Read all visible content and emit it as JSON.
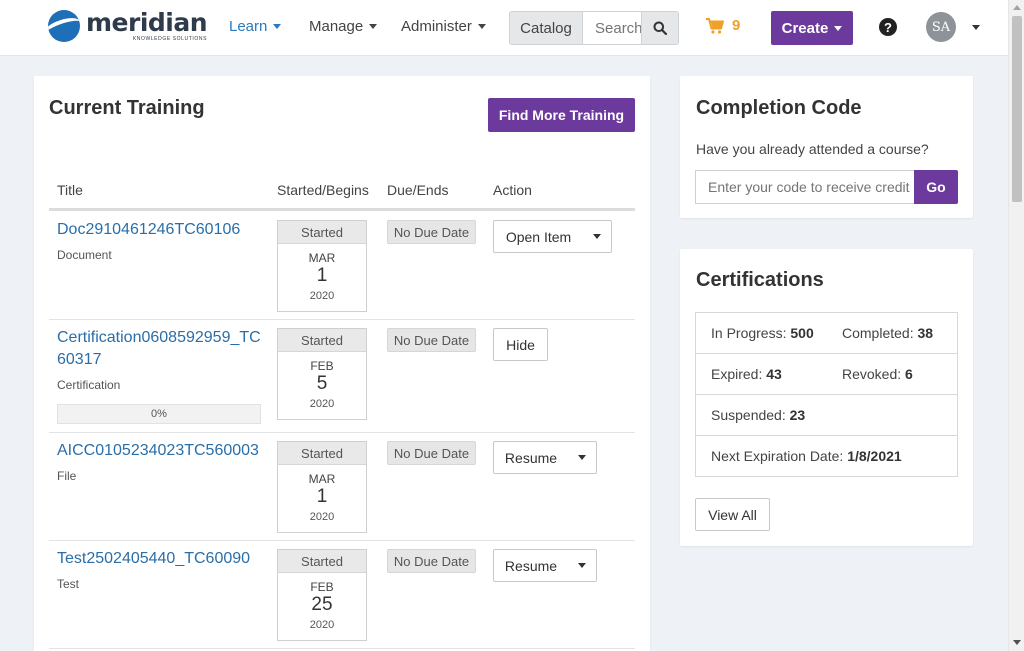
{
  "brand": {
    "name": "meridian",
    "tagline": "KNOWLEDGE SOLUTIONS",
    "accent": "#6b3a9c",
    "link_color": "#2a6ea8"
  },
  "nav": {
    "learn": "Learn",
    "manage": "Manage",
    "administer": "Administer",
    "catalog": "Catalog",
    "search_placeholder": "Search",
    "cart_count": "9",
    "create": "Create",
    "help": "?",
    "user_initials": "SA"
  },
  "training": {
    "title": "Current Training",
    "find_more": "Find More Training",
    "columns": [
      "Title",
      "Started/Begins",
      "Due/Ends",
      "Action"
    ],
    "items": [
      {
        "title": "Doc2910461246TC60106",
        "type": "Document",
        "status": "Started",
        "month": "MAR",
        "day": "1",
        "year": "2020",
        "due": "No Due Date",
        "action": "Open Item",
        "has_menu": true
      },
      {
        "title": "Certification0608592959_TC60317",
        "title_line1": "Certification0608592959_TC",
        "title_line2": "60317",
        "type": "Certification",
        "progress": "0%",
        "status": "Started",
        "month": "FEB",
        "day": "5",
        "year": "2020",
        "due": "No Due Date",
        "action": "Hide",
        "has_menu": false
      },
      {
        "title": "AICC0105234023TC560003",
        "type": "File",
        "status": "Started",
        "month": "MAR",
        "day": "1",
        "year": "2020",
        "due": "No Due Date",
        "action": "Resume",
        "has_menu": true
      },
      {
        "title": "Test2502405440_TC60090",
        "type": "Test",
        "status": "Started",
        "month": "FEB",
        "day": "25",
        "year": "2020",
        "due": "No Due Date",
        "action": "Resume",
        "has_menu": true
      }
    ]
  },
  "completion_code": {
    "title": "Completion Code",
    "question": "Have you already attended a course?",
    "placeholder": "Enter your code to receive credit",
    "go": "Go"
  },
  "certifications": {
    "title": "Certifications",
    "in_progress_label": "In Progress:",
    "in_progress": "500",
    "completed_label": "Completed:",
    "completed": "38",
    "expired_label": "Expired:",
    "expired": "43",
    "revoked_label": "Revoked:",
    "revoked": "6",
    "suspended_label": "Suspended:",
    "suspended": "23",
    "next_exp_label": "Next Expiration Date:",
    "next_exp": "1/8/2021",
    "view_all": "View All"
  }
}
